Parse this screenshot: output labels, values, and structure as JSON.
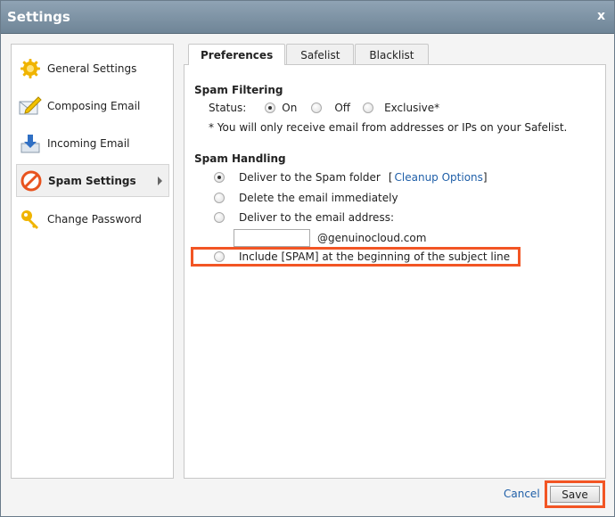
{
  "window": {
    "title": "Settings",
    "close_label": "x"
  },
  "sidebar": {
    "items": [
      {
        "label": "General Settings",
        "icon": "gear-icon"
      },
      {
        "label": "Composing Email",
        "icon": "compose-envelope-icon"
      },
      {
        "label": "Incoming Email",
        "icon": "incoming-arrow-icon"
      },
      {
        "label": "Spam Settings",
        "icon": "no-entry-icon",
        "active": true
      },
      {
        "label": "Change Password",
        "icon": "key-icon"
      }
    ]
  },
  "tabs": [
    {
      "label": "Preferences",
      "active": true
    },
    {
      "label": "Safelist"
    },
    {
      "label": "Blacklist"
    }
  ],
  "spam_filtering": {
    "title": "Spam Filtering",
    "status_label": "Status:",
    "options": [
      {
        "label": "On",
        "selected": true
      },
      {
        "label": "Off",
        "selected": false
      },
      {
        "label": "Exclusive*",
        "selected": false
      }
    ],
    "note": "* You will only receive email from addresses or IPs on your Safelist."
  },
  "spam_handling": {
    "title": "Spam Handling",
    "options": [
      {
        "label": "Deliver to the Spam folder",
        "selected": true
      },
      {
        "label": "Delete the email immediately",
        "selected": false
      },
      {
        "label": "Deliver to the email address:",
        "selected": false
      },
      {
        "label": "Include [SPAM] at the beginning of the subject line",
        "selected": false
      }
    ],
    "cleanup_link": "Cleanup Options",
    "bracket_open": "[",
    "bracket_close": "]",
    "email_input_value": "",
    "email_domain": "@genuinocloud.com"
  },
  "footer": {
    "cancel_label": "Cancel",
    "save_label": "Save"
  },
  "colors": {
    "highlight": "#f25524",
    "link": "#1f5fa8",
    "titlebar": "#7f94a6"
  }
}
